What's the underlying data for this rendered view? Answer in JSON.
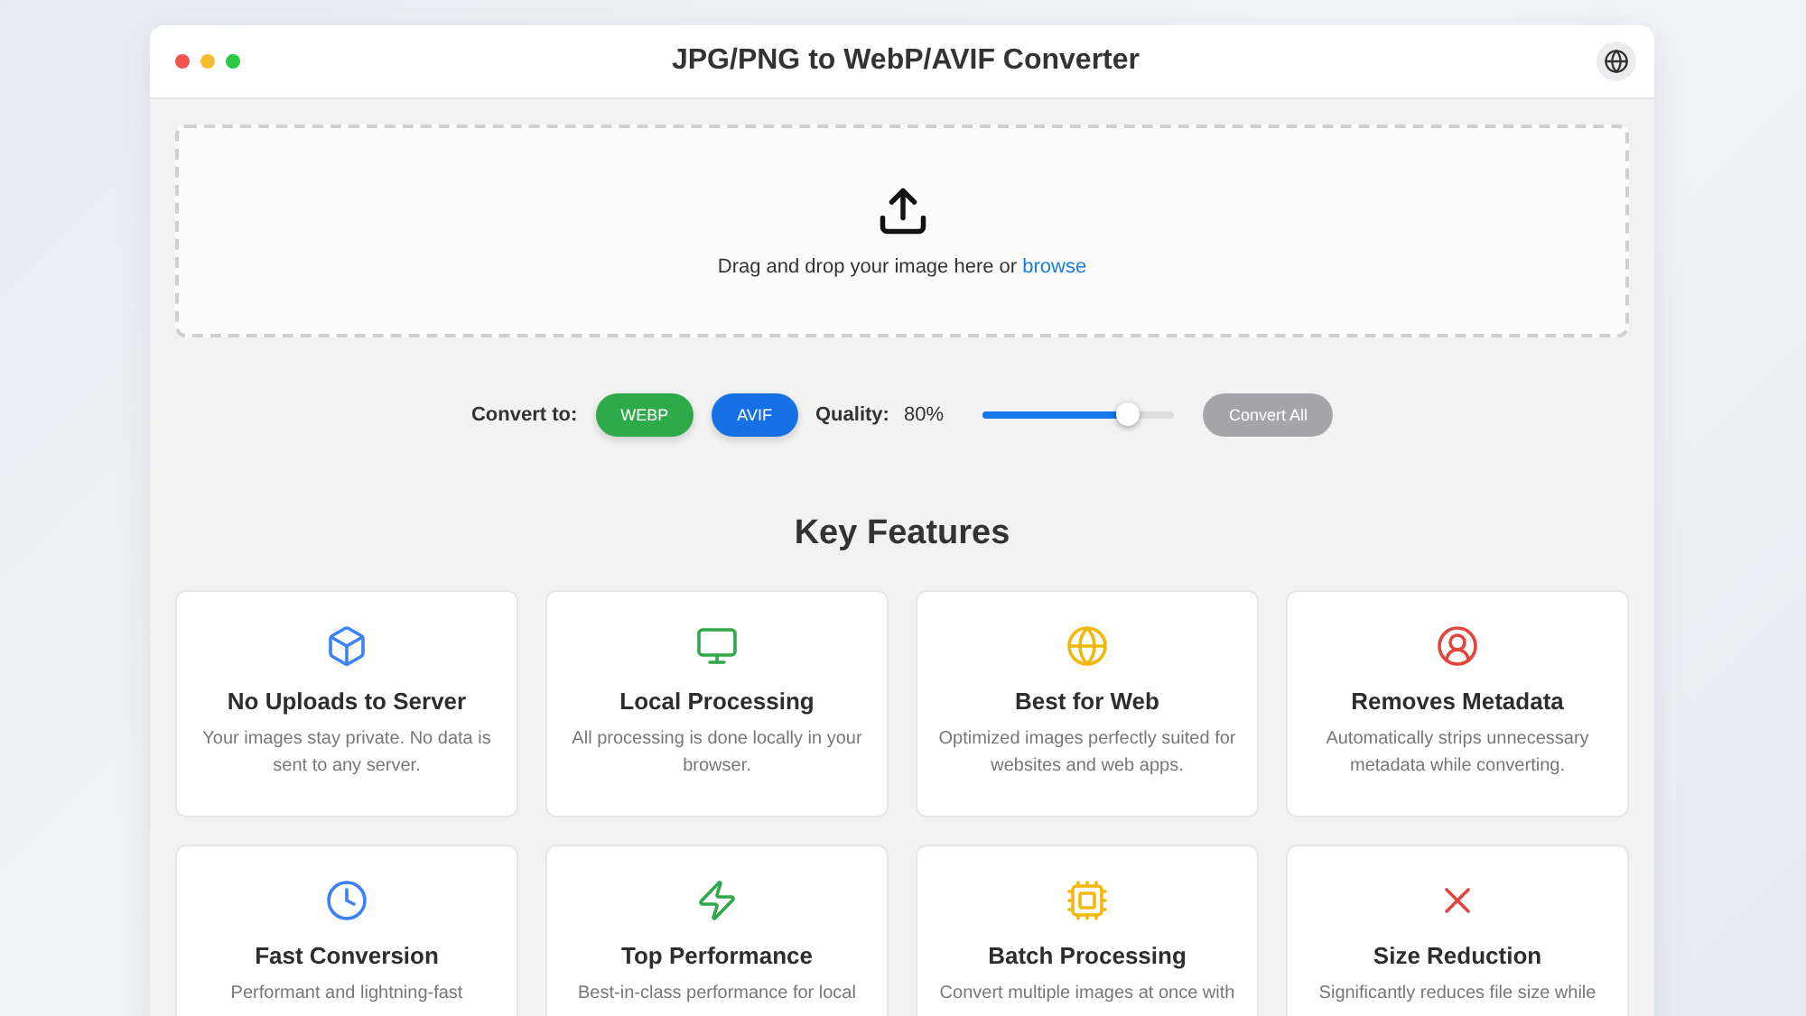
{
  "window": {
    "title": "JPG/PNG to WebP/AVIF Converter"
  },
  "dropzone": {
    "text": "Drag and drop your image here or",
    "link": "browse"
  },
  "controls": {
    "convert_label": "Convert to:",
    "formats": [
      {
        "label": "WEBP",
        "color": "#2eaa4a"
      },
      {
        "label": "AVIF",
        "color": "#1670e6"
      }
    ],
    "quality_label": "Quality:",
    "quality_value": "80%",
    "level": 0.75,
    "convert_all": {
      "label": "Convert All",
      "disabled": true
    }
  },
  "features": {
    "heading": "Key Features",
    "cards": [
      {
        "kind": "box",
        "color": "#3b82f6",
        "title": "No Uploads to Server",
        "description": "Your images stay private. No data is sent to any server."
      },
      {
        "kind": "monitor",
        "color": "#2ea84a",
        "title": "Local Processing",
        "description": "All processing is done locally in your browser."
      },
      {
        "kind": "globe",
        "color": "#f2b90c",
        "title": "Best for Web",
        "description": "Optimized images perfectly suited for websites and web apps."
      },
      {
        "kind": "user",
        "color": "#e2453c",
        "title": "Removes Metadata",
        "description": "Automatically strips unnecessary metadata while converting."
      },
      {
        "kind": "clock",
        "color": "#3b82f6",
        "title": "Fast Conversion",
        "description": "Performant and lightning-fast"
      },
      {
        "kind": "zap",
        "color": "#2ea84a",
        "title": "Top Performance",
        "description": "Best-in-class performance for local"
      },
      {
        "kind": "cpu",
        "color": "#f2b90c",
        "title": "Batch Processing",
        "description": "Convert multiple images at once with"
      },
      {
        "kind": "x",
        "color": "#e2453c",
        "title": "Size Reduction",
        "description": "Significantly reduces file size while"
      }
    ]
  }
}
